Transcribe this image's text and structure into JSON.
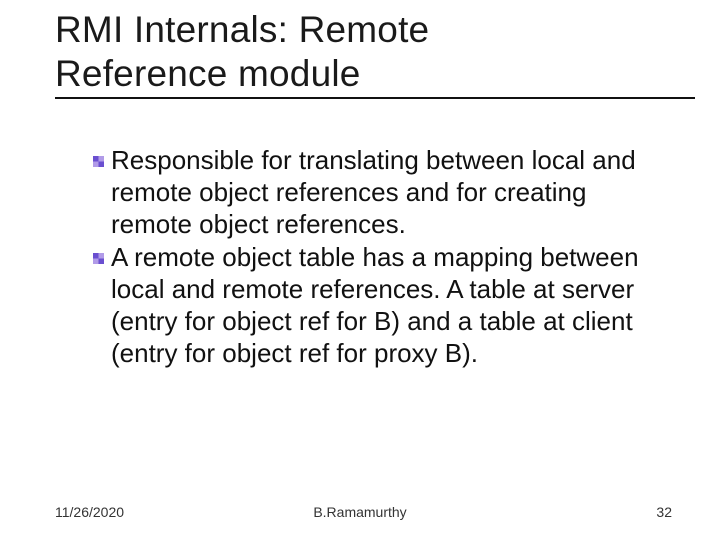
{
  "title_line1": "RMI Internals: Remote",
  "title_line2": "Reference module",
  "bullets": [
    "Responsible for translating between local and remote object references and for creating remote object references.",
    "A remote object table has a mapping between local and remote references. A table at server (entry for object ref for B) and a table at client (entry for object ref for proxy B)."
  ],
  "footer": {
    "date": "11/26/2020",
    "author": "B.Ramamurthy",
    "page": "32"
  }
}
